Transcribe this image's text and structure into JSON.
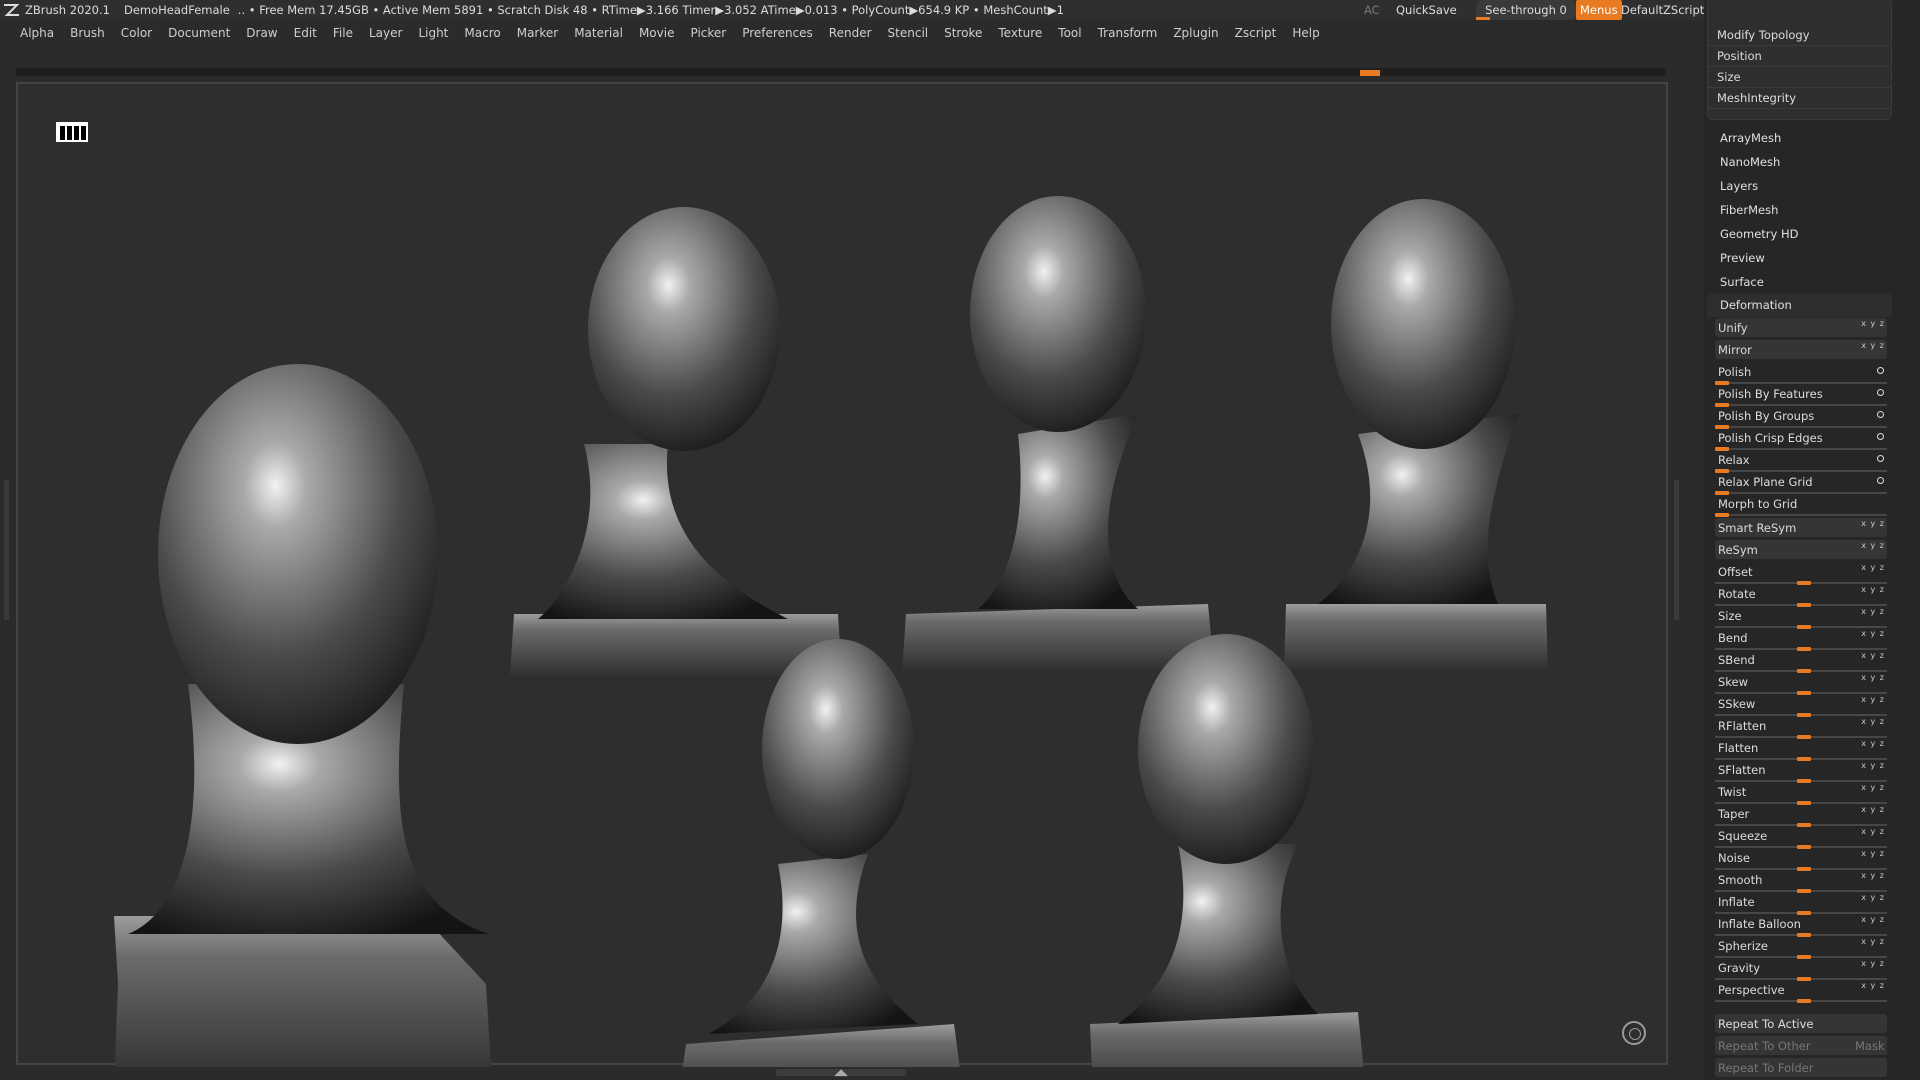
{
  "titlebar": {
    "app": "ZBrush 2020.1",
    "document": "DemoHeadFemale",
    "stats": "..  • Free Mem 17.45GB • Active Mem 5891 • Scratch Disk 48 •  RTime▶3.166 Timer▶3.052 ATime▶0.013 • PolyCount▶654.9 KP  • MeshCount▶1",
    "ac": "AC",
    "quicksave": "QuickSave",
    "seethrough": "See-through   0",
    "menus": "Menus",
    "script": "DefaultZScript"
  },
  "menubar": [
    "Alpha",
    "Brush",
    "Color",
    "Document",
    "Draw",
    "Edit",
    "File",
    "Layer",
    "Light",
    "Macro",
    "Marker",
    "Material",
    "Movie",
    "Picker",
    "Preferences",
    "Render",
    "Stencil",
    "Stroke",
    "Texture",
    "Tool",
    "Transform",
    "Zplugin",
    "Zscript",
    "Help"
  ],
  "panel": {
    "top_items": [
      "Modify Topology",
      "Position",
      "Size",
      "MeshIntegrity"
    ],
    "subpalettes": [
      "ArrayMesh",
      "NanoMesh",
      "Layers",
      "FiberMesh",
      "Geometry HD",
      "Preview",
      "Surface"
    ],
    "deformation_title": "Deformation",
    "deform_buttons": [
      "Unify",
      "Mirror"
    ],
    "polish_items": [
      "Polish",
      "Polish By Features",
      "Polish By Groups",
      "Polish Crisp Edges",
      "Relax",
      "Relax Plane Grid",
      "Morph to Grid"
    ],
    "resym_buttons": [
      "Smart ReSym",
      "ReSym"
    ],
    "sliders": [
      "Offset",
      "Rotate",
      "Size",
      "Bend",
      "SBend",
      "Skew",
      "SSkew",
      "RFlatten",
      "Flatten",
      "SFlatten",
      "Twist",
      "Taper",
      "Squeeze",
      "Noise",
      "Smooth",
      "Inflate",
      "Inflate Balloon",
      "Spherize",
      "Gravity",
      "Perspective"
    ],
    "repeat_active": "Repeat To Active",
    "repeat_other": "Repeat To Other",
    "mask": "Mask",
    "repeat_folder": "Repeat To Folder"
  },
  "colors": {
    "accent": "#e87a22",
    "bg": "#2b2b2b",
    "panel": "#262626"
  }
}
